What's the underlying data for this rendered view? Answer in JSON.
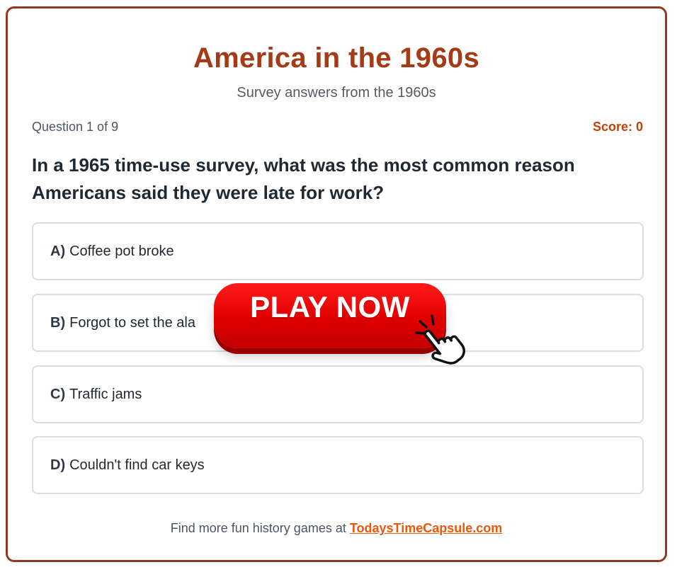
{
  "header": {
    "title": "America in the 1960s",
    "subtitle": "Survey answers from the 1960s"
  },
  "status": {
    "progress": "Question 1 of 9",
    "score": "Score: 0"
  },
  "question": {
    "text": "In a 1965 time-use survey, what was the most common reason Americans said they were late for work?"
  },
  "options": [
    {
      "letter": "A)",
      "label": "Coffee pot broke"
    },
    {
      "letter": "B)",
      "label": "Forgot to set the ala"
    },
    {
      "letter": "C)",
      "label": "Traffic jams"
    },
    {
      "letter": "D)",
      "label": "Couldn't find car keys"
    }
  ],
  "overlay": {
    "play_label": "PLAY NOW",
    "cursor_icon": "hand-pointer-icon"
  },
  "footer": {
    "text": "Find more fun history games at",
    "link_text": "TodaysTimeCapsule.com"
  },
  "colors": {
    "accent": "#a43a16",
    "border": "#8f3a1c",
    "score": "#c2410c",
    "link": "#ea580c",
    "play_button": "#e00000"
  }
}
